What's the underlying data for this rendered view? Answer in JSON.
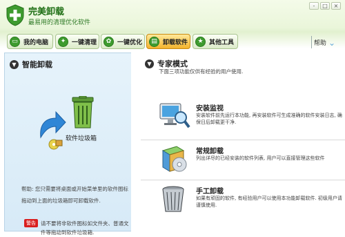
{
  "app": {
    "title": "完美卸载",
    "subtitle": "最易用的清理优化软件"
  },
  "window_controls": [
    "-",
    "□",
    "×"
  ],
  "tabs": [
    {
      "label": "我的电脑",
      "icon": "computer-icon",
      "active": false
    },
    {
      "label": "一键清理",
      "icon": "clean-icon",
      "active": false
    },
    {
      "label": "一键优化",
      "icon": "optimize-icon",
      "active": false
    },
    {
      "label": "卸载软件",
      "icon": "uninstall-icon",
      "active": true
    },
    {
      "label": "其他工具",
      "icon": "tools-icon",
      "active": false
    }
  ],
  "help": {
    "label": "帮助"
  },
  "left": {
    "title": "智能卸载",
    "trash_label": "软件垃圾箱",
    "help_text": "帮助: 您只需要将桌面或开始菜单里的软件图标拖动到上面的垃圾箱即可卸载软件.",
    "warn_badge": "警告",
    "warn_text": "请不要将非软件图标如文件夹、普通文件等拖动到软件垃圾箱."
  },
  "right": {
    "title": "专家模式",
    "desc": "下面三项功能仅供有经验的用户使用.",
    "items": [
      {
        "title": "安装监视",
        "desc": "安装软件前先运行本功能, 再安装软件可生成准确的软件安装日志, 确保日后卸载更干净."
      },
      {
        "title": "常规卸载",
        "desc": "列出详尽的已经安装的软件列表, 用户可以直接管理这些软件"
      },
      {
        "title": "手工卸载",
        "desc": "如果有顽固的软件, 有经验用户可以使用本功能卸载软件. 初级用户请谨慎使用."
      }
    ]
  },
  "colors": {
    "brand_green": "#3e9b2f",
    "active_tab": "#f3b32c",
    "left_panel_bg": "#d7eaf7",
    "warning_red": "#d91f1f"
  }
}
